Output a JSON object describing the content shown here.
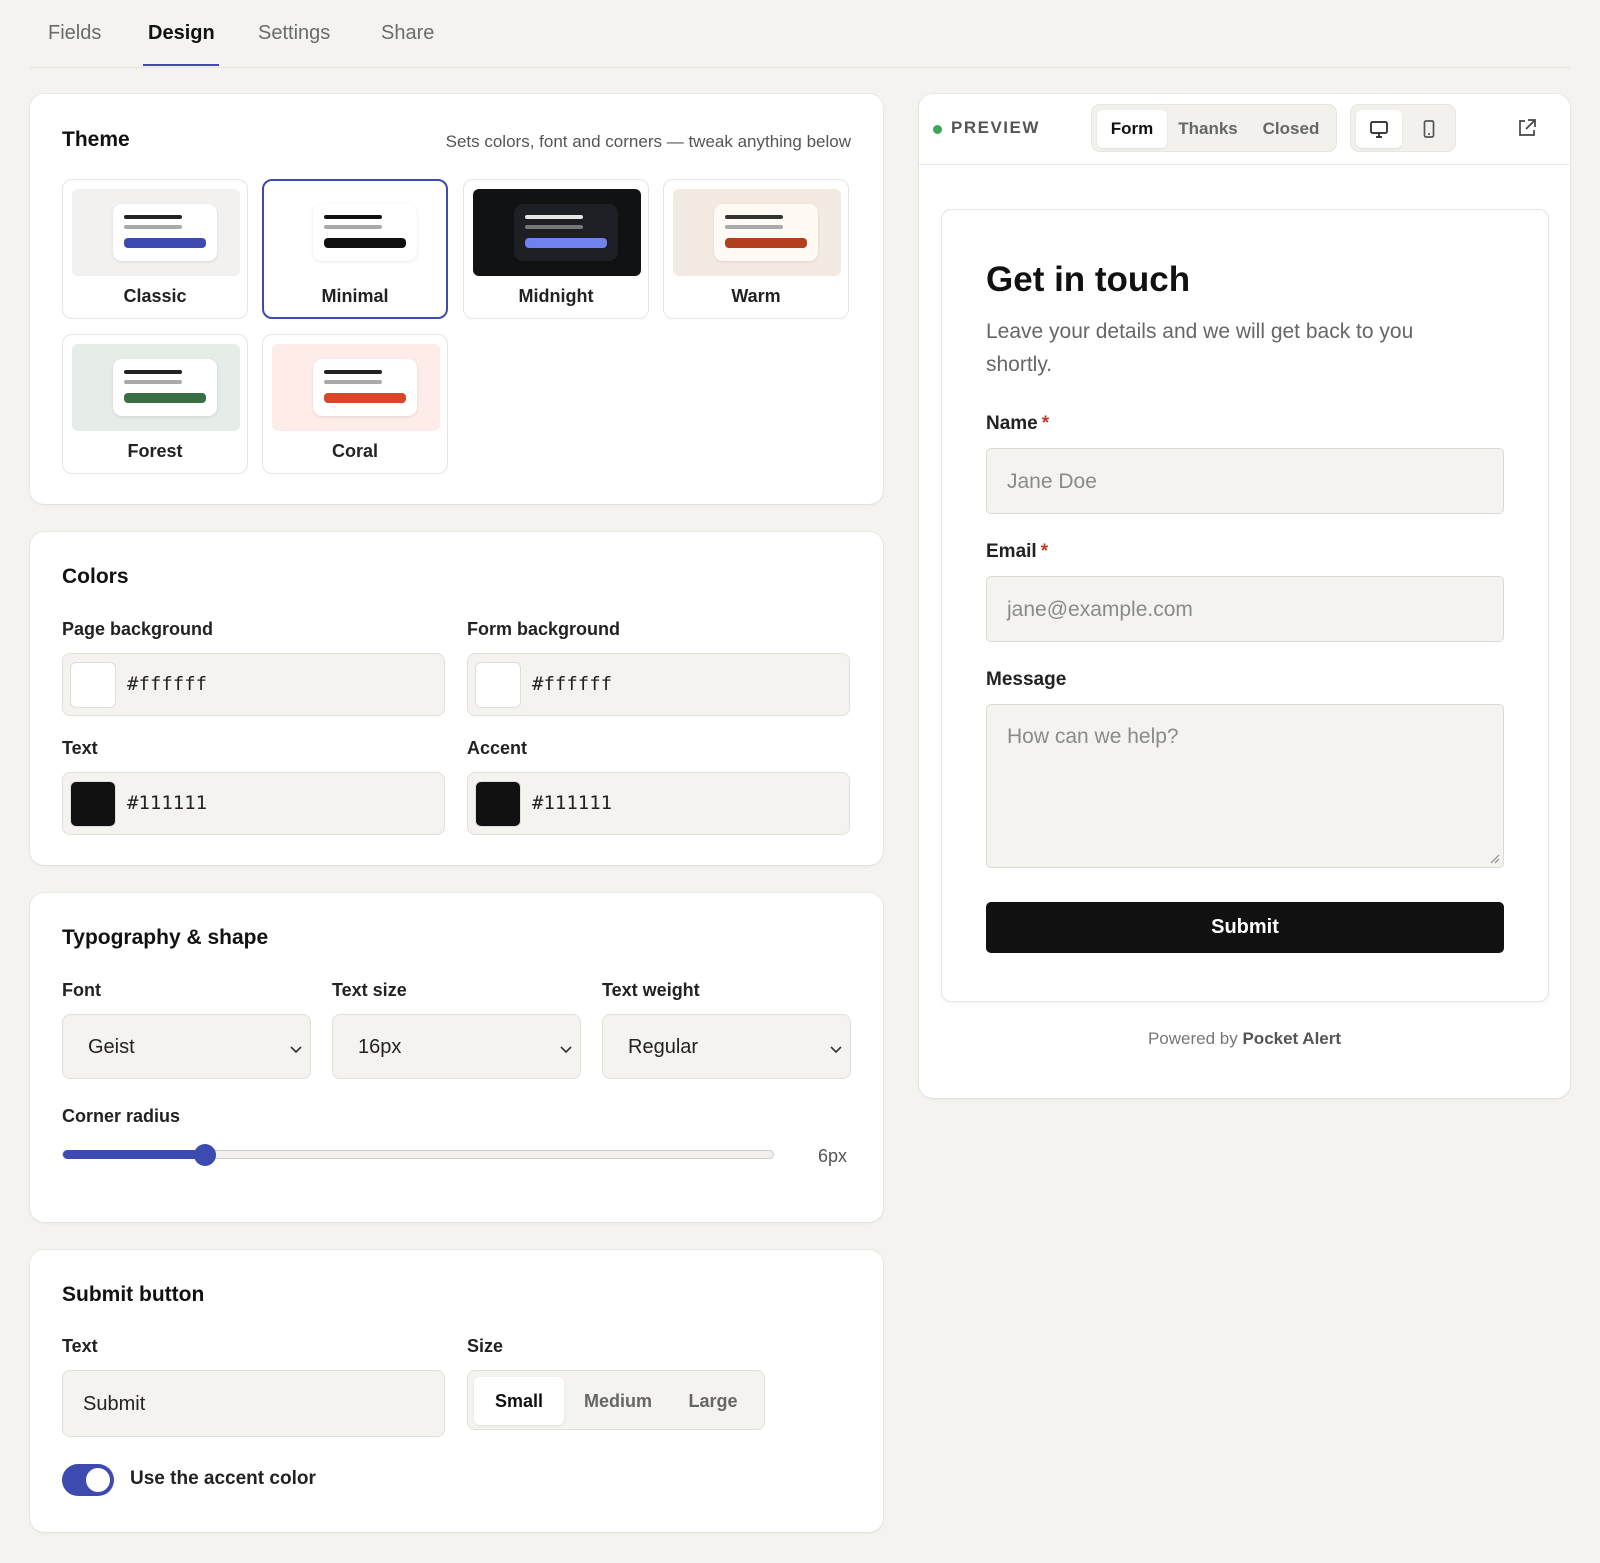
{
  "tabs": [
    {
      "label": "Fields"
    },
    {
      "label": "Design"
    },
    {
      "label": "Settings"
    },
    {
      "label": "Share"
    }
  ],
  "active_tab": "Design",
  "theme": {
    "title": "Theme",
    "hint": "Sets colors, font and corners — tweak anything below",
    "selected": "Minimal",
    "options": [
      {
        "label": "Classic",
        "bg": "#f2f1ef",
        "card": "#ffffff",
        "line1": "#222222",
        "line2": "#aaaaaa",
        "bar": "#3d4bb0"
      },
      {
        "label": "Minimal",
        "bg": "#ffffff",
        "card": "#ffffff",
        "line1": "#111111",
        "line2": "#aaaaaa",
        "bar": "#111111"
      },
      {
        "label": "Midnight",
        "bg": "#111214",
        "card": "#1d1f24",
        "line1": "#e6e6e6",
        "line2": "#777777",
        "bar": "#6f82f0"
      },
      {
        "label": "Warm",
        "bg": "#f3ebe2",
        "card": "#fffaf4",
        "line1": "#333333",
        "line2": "#aaaaaa",
        "bar": "#b3401d"
      },
      {
        "label": "Forest",
        "bg": "#e6ece7",
        "card": "#ffffff",
        "line1": "#222222",
        "line2": "#aaaaaa",
        "bar": "#3c6e45"
      },
      {
        "label": "Coral",
        "bg": "#fdece7",
        "card": "#ffffff",
        "line1": "#222222",
        "line2": "#aaaaaa",
        "bar": "#d9472b"
      }
    ]
  },
  "colors": {
    "title": "Colors",
    "page_background": {
      "label": "Page background",
      "value": "#ffffff"
    },
    "form_background": {
      "label": "Form background",
      "value": "#ffffff"
    },
    "text": {
      "label": "Text",
      "value": "#111111"
    },
    "accent": {
      "label": "Accent",
      "value": "#111111"
    }
  },
  "typography": {
    "title": "Typography & shape",
    "font": {
      "label": "Font",
      "value": "Geist"
    },
    "text_size": {
      "label": "Text size",
      "value": "16px"
    },
    "text_weight": {
      "label": "Text weight",
      "value": "Regular"
    },
    "corner_radius": {
      "label": "Corner radius",
      "value_label": "6px",
      "fraction": 0.2
    }
  },
  "submit_button": {
    "title": "Submit button",
    "text_label": "Text",
    "text_value": "Submit",
    "size_label": "Size",
    "sizes": [
      "Small",
      "Medium",
      "Large"
    ],
    "selected_size": "Small",
    "accent_toggle_label": "Use the accent color",
    "accent_toggle_on": true
  },
  "preview": {
    "label": "PREVIEW",
    "status_color": "#3aa757",
    "views": [
      "Form",
      "Thanks",
      "Closed"
    ],
    "active_view": "Form",
    "devices": [
      "desktop-icon",
      "mobile-icon"
    ],
    "form": {
      "heading": "Get in touch",
      "description": "Leave your details and we will get back to you shortly.",
      "fields": [
        {
          "label": "Name",
          "required": "*",
          "placeholder": "Jane Doe"
        },
        {
          "label": "Email",
          "required": "*",
          "placeholder": "jane@example.com"
        },
        {
          "label": "Message",
          "placeholder": "How can we help?"
        }
      ],
      "submit_label": "Submit"
    },
    "powered_by_prefix": "Powered by",
    "powered_by_brand": "Pocket Alert"
  }
}
